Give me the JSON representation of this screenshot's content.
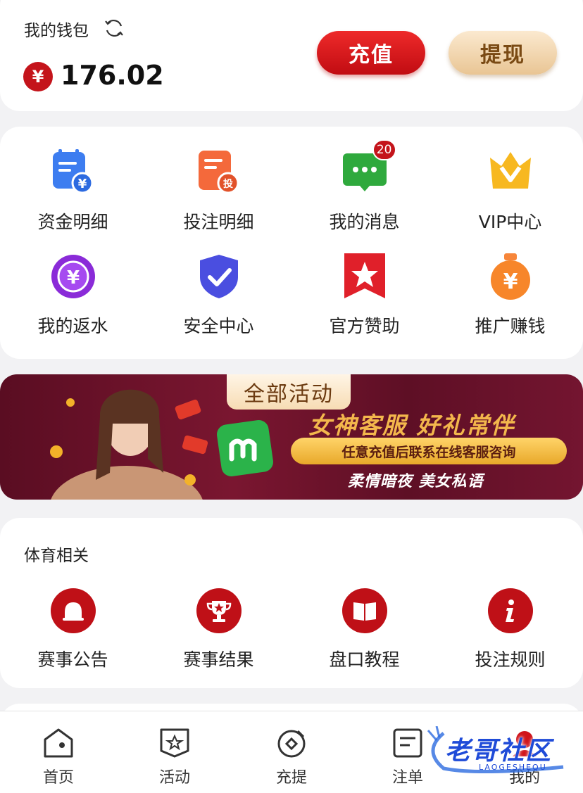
{
  "wallet": {
    "title": "我的钱包",
    "currency_symbol": "¥",
    "balance": "176.02",
    "recharge_label": "充值",
    "withdraw_label": "提现"
  },
  "menu": [
    {
      "label": "资金明细",
      "icon": "fund-details-icon"
    },
    {
      "label": "投注明细",
      "icon": "bet-details-icon"
    },
    {
      "label": "我的消息",
      "icon": "messages-icon",
      "badge": "20"
    },
    {
      "label": "VIP中心",
      "icon": "vip-crown-icon"
    },
    {
      "label": "我的返水",
      "icon": "rebate-chip-icon"
    },
    {
      "label": "安全中心",
      "icon": "security-shield-icon"
    },
    {
      "label": "官方赞助",
      "icon": "sponsor-star-icon"
    },
    {
      "label": "推广赚钱",
      "icon": "promote-coin-icon"
    }
  ],
  "banner": {
    "tab_label": "全部活动",
    "headline": "女神客服  好礼常伴",
    "pill_text": "任意充值后联系在线客服咨询",
    "subline": "柔情暗夜 美女私语"
  },
  "sports": {
    "title": "体育相关",
    "items": [
      {
        "label": "赛事公告",
        "icon": "bell-icon"
      },
      {
        "label": "赛事结果",
        "icon": "trophy-icon"
      },
      {
        "label": "盘口教程",
        "icon": "book-icon"
      },
      {
        "label": "投注规则",
        "icon": "info-icon"
      }
    ]
  },
  "tabbar": [
    {
      "label": "首页",
      "icon": "home-icon"
    },
    {
      "label": "活动",
      "icon": "activity-star-icon"
    },
    {
      "label": "充提",
      "icon": "deposit-withdraw-icon"
    },
    {
      "label": "注单",
      "icon": "orders-icon"
    },
    {
      "label": "我的",
      "icon": "profile-icon"
    }
  ],
  "watermark": {
    "text": "老哥社区",
    "sub": "LAOGESHEQU"
  },
  "colors": {
    "brand_red": "#c4141b",
    "gold": "#e9c594",
    "banner_bg": "#6a1229"
  }
}
